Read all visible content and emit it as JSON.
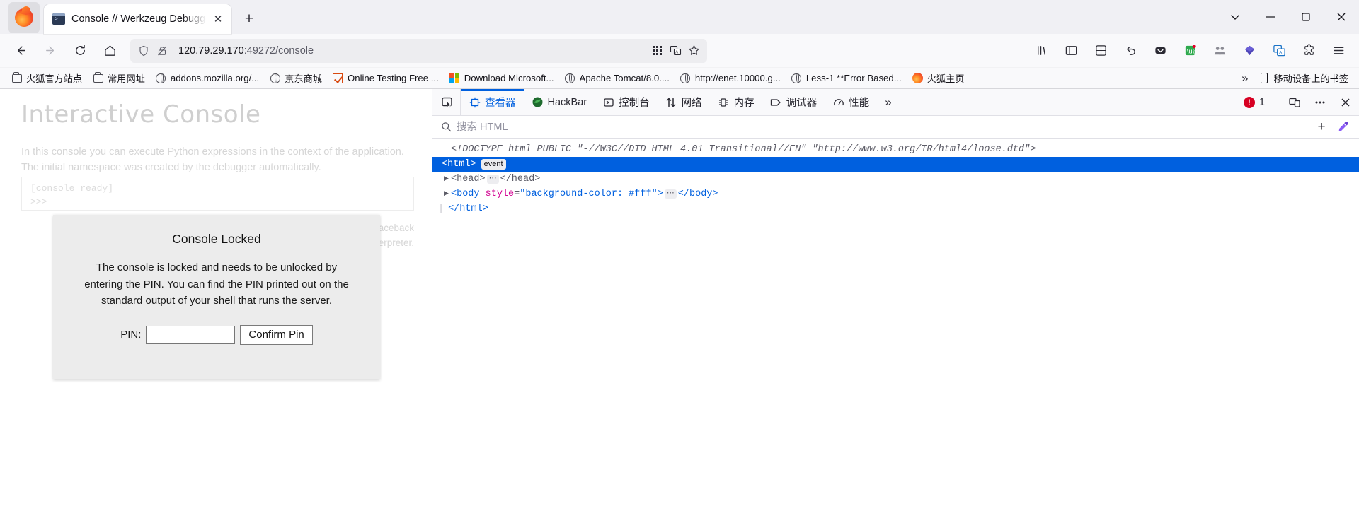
{
  "window": {
    "tab_title": "Console // Werkzeug Debugger",
    "new_tab_label": "+",
    "minimize_label": "–",
    "maximize_label": "❐",
    "close_label": "✕",
    "tab_close_label": "✕",
    "list_all_tabs_label": "∨"
  },
  "navbar": {
    "back_label": "←",
    "forward_label": "→",
    "reload_label": "↻",
    "home_label": "⌂",
    "url_host": "120.79.29.170",
    "url_rest": ":49272/console",
    "url_full": "120.79.29.170:49272/console",
    "shield_icon": "shield-icon",
    "lock_icon": "lock-broken-icon",
    "qr_icon": "qr-icon",
    "translate_icon": "translate-icon",
    "bookmark_star_icon": "star-icon",
    "library_icon": "library-icon",
    "sidebar_icon": "sidebar-icon",
    "container_icon": "container-icon",
    "undo_icon": "undo-icon",
    "pocket_icon": "pocket-icon",
    "grab_icon": "grab-icon",
    "people_icon": "people-icon",
    "gem_icon": "gem-icon",
    "translate2_icon": "translate-alt-icon",
    "extensions_icon": "extensions-icon",
    "menu_icon": "hamburger-menu-icon"
  },
  "bookmarks": {
    "items": [
      {
        "label": "火狐官方站点",
        "icon": "folder"
      },
      {
        "label": "常用网址",
        "icon": "folder"
      },
      {
        "label": "addons.mozilla.org/...",
        "icon": "globe"
      },
      {
        "label": "京东商城",
        "icon": "globe"
      },
      {
        "label": "Online Testing Free ...",
        "icon": "check"
      },
      {
        "label": "Download Microsoft...",
        "icon": "ms"
      },
      {
        "label": "Apache Tomcat/8.0....",
        "icon": "globe"
      },
      {
        "label": "http://enet.10000.g...",
        "icon": "globe"
      },
      {
        "label": "Less-1 **Error Based...",
        "icon": "globe"
      },
      {
        "label": "火狐主页",
        "icon": "firefox"
      }
    ],
    "overflow_label": "»",
    "mobile_label": "移动设备上的书签"
  },
  "page": {
    "heading": "Interactive Console",
    "intro": "In this console you can execute Python expressions in the context of the application. The initial namespace was created by the debugger automatically.",
    "console_prompt_1": "[console ready]",
    "console_prompt_2": ">>>",
    "footer_note_1": "aceback",
    "footer_note_2": "interpreter."
  },
  "dialog": {
    "title": "Console Locked",
    "message": "The console is locked and needs to be unlocked by entering the PIN. You can find the PIN printed out on the standard output of your shell that runs the server.",
    "pin_label": "PIN:",
    "pin_value": "",
    "confirm_label": "Confirm Pin"
  },
  "devtools": {
    "picker_icon": "element-picker-icon",
    "tabs": [
      {
        "label": "查看器",
        "icon": "inspector-icon",
        "active": true
      },
      {
        "label": "HackBar",
        "icon": "hackbar-icon",
        "active": false
      },
      {
        "label": "控制台",
        "icon": "console-icon",
        "active": false
      },
      {
        "label": "网络",
        "icon": "network-icon",
        "active": false
      },
      {
        "label": "内存",
        "icon": "memory-icon",
        "active": false
      },
      {
        "label": "调试器",
        "icon": "debugger-icon",
        "active": false
      },
      {
        "label": "性能",
        "icon": "performance-icon",
        "active": false
      }
    ],
    "more_tabs_label": "»",
    "error_count": "1",
    "responsive_icon": "responsive-design-mode-icon",
    "meatball_icon": "more-options-icon",
    "close_icon": "close-icon",
    "search": {
      "placeholder": "搜索 HTML",
      "value": "",
      "search_icon": "search-icon",
      "add_node_label": "+",
      "eyedropper_icon": "eyedropper-icon"
    },
    "markup": {
      "doctype": "<!DOCTYPE html PUBLIC \"-//W3C//DTD HTML 4.01 Transitional//EN\" \"http://www.w3.org/TR/html4/loose.dtd\">",
      "html_open": "<html>",
      "html_badge": "event",
      "head_line": "<head>",
      "head_close": "</head>",
      "body_tag": "<body",
      "body_attr_name": "style",
      "body_attr_value": "\"background-color: #fff\"",
      "body_tag_end": ">",
      "body_close": "</body>",
      "html_close": "</html>",
      "ellipsis": "…"
    }
  },
  "colors": {
    "accent": "#0060df",
    "error": "#d70022",
    "chrome_bg": "#f9f9fb",
    "tabstrip_bg": "#f0f0f4",
    "dialog_bg": "#ececec"
  }
}
